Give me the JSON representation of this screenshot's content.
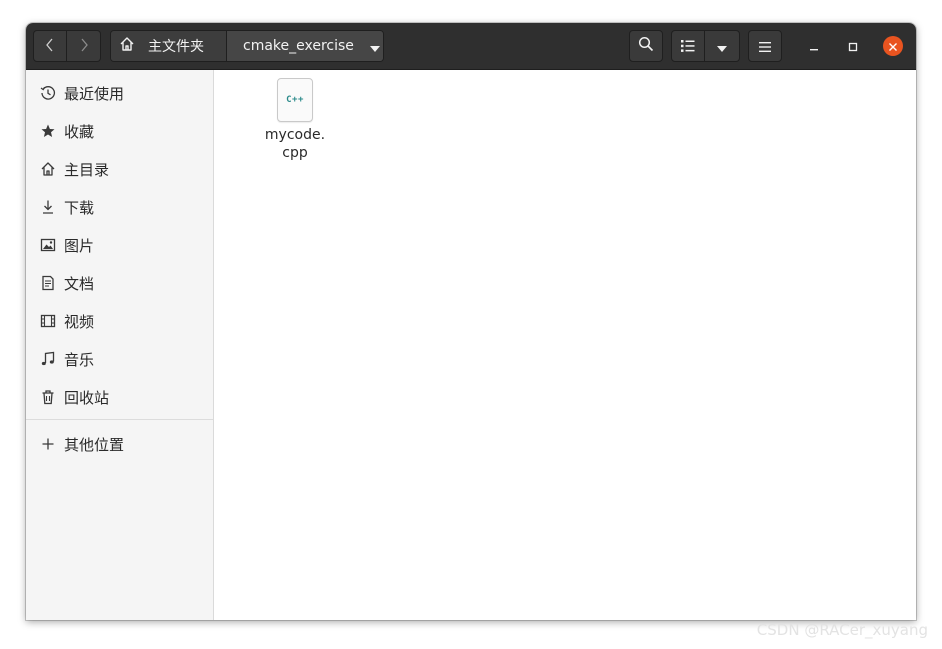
{
  "header": {
    "path": {
      "home_label": "主文件夹",
      "current_label": "cmake_exercise"
    }
  },
  "sidebar": {
    "items": [
      {
        "label": "最近使用",
        "icon": "clock-icon"
      },
      {
        "label": "收藏",
        "icon": "star-icon"
      },
      {
        "label": "主目录",
        "icon": "home-icon"
      },
      {
        "label": "下载",
        "icon": "download-icon"
      },
      {
        "label": "图片",
        "icon": "image-icon"
      },
      {
        "label": "文档",
        "icon": "document-icon"
      },
      {
        "label": "视频",
        "icon": "video-icon"
      },
      {
        "label": "音乐",
        "icon": "music-icon"
      },
      {
        "label": "回收站",
        "icon": "trash-icon"
      }
    ],
    "other_locations": {
      "label": "其他位置",
      "icon": "plus-icon"
    }
  },
  "files": [
    {
      "name": "mycode.\ncpp",
      "icon_text": "C++"
    }
  ],
  "watermark": "CSDN @RACer_xuyang",
  "colors": {
    "header": "#2f2f2f",
    "close": "#e95420",
    "sidebar": "#f5f5f5",
    "cpp_icon": "#2a8a8a"
  }
}
